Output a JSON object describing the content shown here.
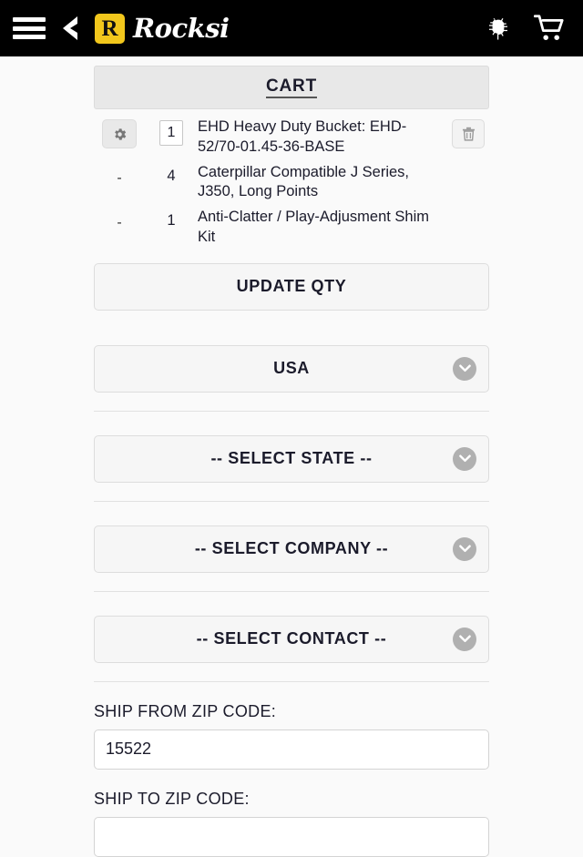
{
  "header": {
    "menu_icon": "hamburger-menu-icon",
    "back_icon": "back-chevron-icon",
    "logo_mark": "R",
    "logo_text": "Rocksi",
    "bug_icon": "bug-icon",
    "cart_icon": "shopping-cart-icon"
  },
  "cart": {
    "title": "CART",
    "gear_icon": "gear-icon",
    "trash_icon": "trash-icon",
    "items": [
      {
        "qty": "1",
        "description": "EHD Heavy Duty Bucket: EHD-52/70-01.45-36-BASE",
        "is_sub": false
      },
      {
        "dash": "-",
        "qty": "4",
        "description": "Caterpillar Compatible J Series, J350, Long Points",
        "is_sub": true
      },
      {
        "dash": "-",
        "qty": "1",
        "description": "Anti-Clatter / Play-Adjusment Shim Kit",
        "is_sub": true
      }
    ],
    "update_qty_label": "UPDATE QTY"
  },
  "selectors": [
    {
      "label": "USA",
      "name": "country-select"
    },
    {
      "label": "-- SELECT STATE --",
      "name": "state-select"
    },
    {
      "label": "-- SELECT COMPANY --",
      "name": "company-select"
    },
    {
      "label": "-- SELECT CONTACT --",
      "name": "contact-select"
    }
  ],
  "ship_from": {
    "label": "SHIP FROM ZIP CODE:",
    "value": "15522",
    "placeholder": ""
  },
  "ship_to": {
    "label": "SHIP TO ZIP CODE:",
    "value": "",
    "placeholder": ""
  },
  "colors": {
    "topbar_bg": "#000000",
    "logo_yellow": "#f2c71c",
    "page_bg": "#fafafa",
    "button_bg": "#f6f6f6",
    "chevron_circle": "#b0b0b0"
  }
}
